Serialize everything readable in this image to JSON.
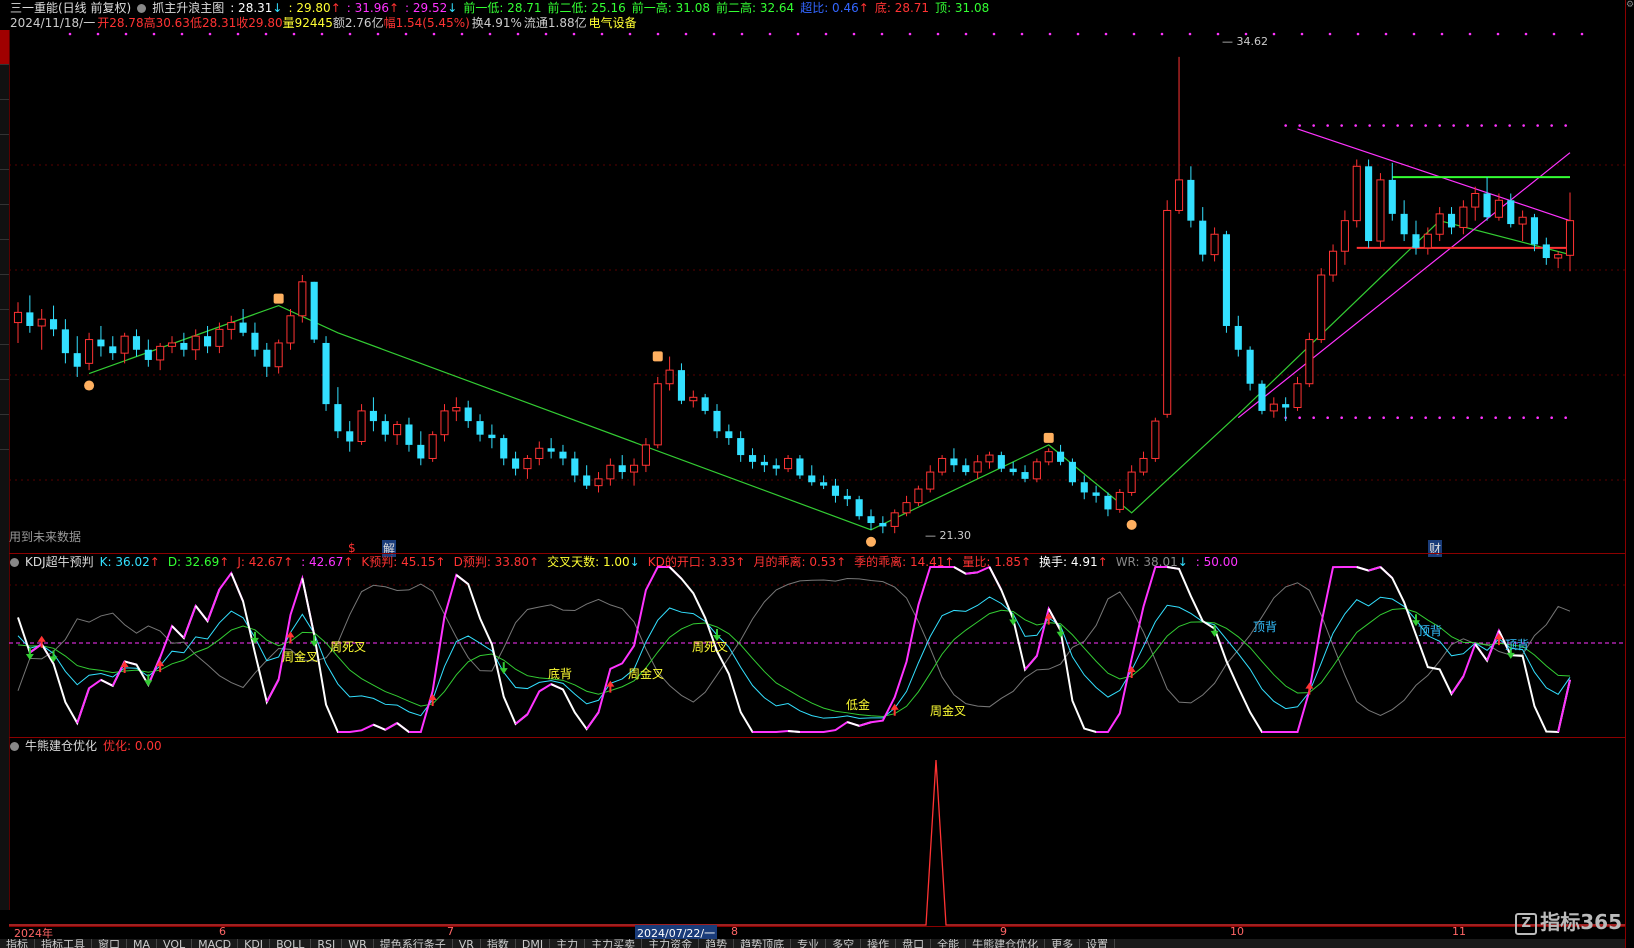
{
  "header": {
    "stock_name": "三一重能(日线 前复权)",
    "indicator": "抓主升浪主图",
    "v1_label": ": 28.31",
    "v1_arrow": "↓",
    "v2": ": 29.80",
    "v2_arrow": "↑",
    "v3": ": 31.96",
    "v3_arrow": "↑",
    "v4": ": 29.52",
    "v4_arrow": "↓",
    "prev_low": "前一低: 28.71",
    "prev2_low": "前二低: 25.16",
    "prev_high": "前一高: 31.08",
    "prev2_high": "前二高: 32.64",
    "ratio": "超比: 0.46",
    "ratio_arrow": "↑",
    "bottom": "底: 28.71",
    "top": "顶: 31.08"
  },
  "info": {
    "date": "2024/11/18/一",
    "open": "开28.78",
    "high": "高30.63",
    "low": "低28.31",
    "close": "收29.80",
    "volume": "量92445",
    "amount": "额2.76亿",
    "change": "幅1.54(5.45%)",
    "turnover": "换4.91%",
    "float": "流通1.88亿",
    "sector": "电气设备"
  },
  "main_notes": {
    "future_data": "用到未来数据",
    "price_high_label": "34.62",
    "price_low_label": "21.30",
    "sig_s": "$",
    "sig_jie": "解",
    "sig_cai": "财",
    "right_axis_mark": "2"
  },
  "kdj": {
    "title": "KDJ超牛预判",
    "items": [
      {
        "text": "K: 36.02",
        "arrow": "↑",
        "color": "#33e0ff"
      },
      {
        "text": "D: 32.69",
        "arrow": "↑",
        "color": "#33ff33"
      },
      {
        "text": "J: 42.67",
        "arrow": "↑",
        "color": "#ff3333"
      },
      {
        "text": ": 42.67",
        "arrow": "↑",
        "color": "#ff33ff"
      },
      {
        "text": "K预判: 45.15",
        "arrow": "↑",
        "color": "#ff3333"
      },
      {
        "text": "D预判: 33.80",
        "arrow": "↑",
        "color": "#ff3333"
      },
      {
        "text": "交叉天数: 1.00",
        "arrow": "↓",
        "color": "#ffff33"
      },
      {
        "text": "KD的开口: 3.33",
        "arrow": "↑",
        "color": "#ff3333"
      },
      {
        "text": "月的乖离: 0.53",
        "arrow": "↑",
        "color": "#ff3333"
      },
      {
        "text": "季的乖离: 14.41",
        "arrow": "↑",
        "color": "#ff3333"
      },
      {
        "text": "量比: 1.85",
        "arrow": "↑",
        "color": "#ff3333"
      },
      {
        "text": "换手: 4.91",
        "arrow": "↑",
        "color": "#ffffff"
      },
      {
        "text": "WR: 38.01",
        "arrow": "↓",
        "color": "#888888"
      },
      {
        "text": ": 50.00",
        "arrow": "",
        "color": "#ff33ff"
      }
    ],
    "labels": [
      {
        "text": "周死叉",
        "color": "#ffff33"
      },
      {
        "text": "周金叉",
        "color": "#ffff33"
      },
      {
        "text": "底背",
        "color": "#ffff33"
      },
      {
        "text": "周金叉",
        "color": "#ffff33"
      },
      {
        "text": "周死叉",
        "color": "#ffff33"
      },
      {
        "text": "低金",
        "color": "#ffff33"
      },
      {
        "text": "周金叉",
        "color": "#ffff33"
      },
      {
        "text": "顶背",
        "color": "#33c0ff"
      },
      {
        "text": "顶背",
        "color": "#33c0ff"
      },
      {
        "text": "顶背",
        "color": "#33c0ff"
      }
    ]
  },
  "bull": {
    "title": "牛熊建仓优化",
    "value_label": "优化: 0.00"
  },
  "dates": [
    {
      "text": "2024年"
    },
    {
      "text": "6"
    },
    {
      "text": "7"
    },
    {
      "text": "2024/07/22/一"
    },
    {
      "text": "8"
    },
    {
      "text": "9"
    },
    {
      "text": "10"
    },
    {
      "text": "11"
    }
  ],
  "tabs": [
    "指标",
    "指标工具",
    "窗口",
    "MA",
    "VOL",
    "MACD",
    "KDJ",
    "BOLL",
    "RSI",
    "WR",
    "提色系行条子",
    "VR",
    "指数",
    "DMI",
    "主力",
    "主力买卖",
    "主力资金",
    "趋势",
    "趋势顶底",
    "专业",
    "多空",
    "操作",
    "盘口",
    "全能",
    "牛熊建仓优化",
    "更多",
    "设置"
  ],
  "logo": {
    "mark": "Z",
    "text": "指标365"
  },
  "colors": {
    "up": "#ff3333",
    "down": "#33e0ff",
    "ma_green": "#33cc33",
    "magenta": "#ff33ff",
    "border": "#8b0000"
  },
  "chart_data": {
    "type": "candlestick",
    "title": "",
    "candles_ohlc": [
      [
        26.8,
        27.4,
        26.2,
        27.1
      ],
      [
        27.1,
        27.6,
        26.5,
        26.7
      ],
      [
        26.7,
        27.2,
        26.0,
        26.9
      ],
      [
        26.9,
        27.3,
        26.4,
        26.6
      ],
      [
        26.6,
        26.9,
        25.6,
        25.9
      ],
      [
        25.9,
        26.4,
        25.2,
        25.5
      ],
      [
        25.6,
        26.5,
        25.4,
        26.3
      ],
      [
        26.3,
        26.7,
        25.8,
        26.1
      ],
      [
        26.1,
        26.4,
        25.7,
        25.9
      ],
      [
        25.9,
        26.5,
        25.6,
        26.4
      ],
      [
        26.4,
        26.6,
        25.8,
        26.0
      ],
      [
        26.0,
        26.3,
        25.5,
        25.7
      ],
      [
        25.7,
        26.2,
        25.4,
        26.1
      ],
      [
        26.1,
        26.4,
        25.9,
        26.2
      ],
      [
        26.2,
        26.5,
        25.8,
        26.0
      ],
      [
        26.0,
        26.6,
        25.7,
        26.4
      ],
      [
        26.4,
        26.7,
        25.9,
        26.1
      ],
      [
        26.1,
        26.8,
        25.9,
        26.6
      ],
      [
        26.6,
        27.0,
        26.3,
        26.8
      ],
      [
        26.8,
        27.2,
        26.4,
        26.5
      ],
      [
        26.5,
        26.8,
        25.8,
        26.0
      ],
      [
        26.0,
        26.2,
        25.2,
        25.5
      ],
      [
        25.5,
        26.3,
        25.3,
        26.2
      ],
      [
        26.2,
        27.2,
        26.0,
        27.0
      ],
      [
        27.0,
        28.2,
        26.8,
        28.0
      ],
      [
        28.0,
        28.0,
        26.2,
        26.3
      ],
      [
        26.2,
        26.4,
        24.2,
        24.4
      ],
      [
        24.4,
        24.9,
        23.4,
        23.6
      ],
      [
        23.6,
        23.9,
        23.0,
        23.3
      ],
      [
        23.3,
        24.4,
        23.2,
        24.2
      ],
      [
        24.2,
        24.6,
        23.6,
        23.9
      ],
      [
        23.9,
        24.1,
        23.3,
        23.5
      ],
      [
        23.5,
        23.9,
        23.2,
        23.8
      ],
      [
        23.8,
        24.0,
        23.0,
        23.2
      ],
      [
        23.2,
        23.6,
        22.6,
        22.8
      ],
      [
        22.8,
        23.6,
        22.7,
        23.5
      ],
      [
        23.5,
        24.4,
        23.3,
        24.2
      ],
      [
        24.2,
        24.6,
        23.9,
        24.3
      ],
      [
        24.3,
        24.5,
        23.7,
        23.9
      ],
      [
        23.9,
        24.1,
        23.3,
        23.5
      ],
      [
        23.5,
        23.8,
        23.1,
        23.4
      ],
      [
        23.4,
        23.5,
        22.6,
        22.8
      ],
      [
        22.8,
        23.0,
        22.3,
        22.5
      ],
      [
        22.5,
        22.9,
        22.2,
        22.8
      ],
      [
        22.8,
        23.3,
        22.6,
        23.1
      ],
      [
        23.1,
        23.4,
        22.8,
        23.0
      ],
      [
        23.0,
        23.2,
        22.6,
        22.8
      ],
      [
        22.8,
        23.0,
        22.1,
        22.3
      ],
      [
        22.3,
        22.6,
        21.9,
        22.0
      ],
      [
        22.0,
        22.4,
        21.8,
        22.2
      ],
      [
        22.2,
        22.8,
        22.0,
        22.6
      ],
      [
        22.6,
        22.9,
        22.2,
        22.4
      ],
      [
        22.4,
        22.8,
        22.0,
        22.6
      ],
      [
        22.6,
        23.4,
        22.4,
        23.2
      ],
      [
        23.2,
        25.2,
        23.1,
        25.0
      ],
      [
        25.0,
        25.8,
        24.8,
        25.4
      ],
      [
        25.4,
        25.6,
        24.4,
        24.5
      ],
      [
        24.5,
        24.8,
        24.3,
        24.6
      ],
      [
        24.6,
        24.7,
        24.1,
        24.2
      ],
      [
        24.2,
        24.4,
        23.4,
        23.6
      ],
      [
        23.6,
        23.8,
        23.2,
        23.4
      ],
      [
        23.4,
        23.6,
        22.7,
        22.9
      ],
      [
        22.9,
        23.1,
        22.5,
        22.7
      ],
      [
        22.7,
        22.9,
        22.4,
        22.6
      ],
      [
        22.6,
        22.8,
        22.3,
        22.5
      ],
      [
        22.5,
        22.9,
        22.4,
        22.8
      ],
      [
        22.8,
        22.9,
        22.2,
        22.3
      ],
      [
        22.3,
        22.6,
        22.0,
        22.1
      ],
      [
        22.1,
        22.3,
        21.9,
        22.0
      ],
      [
        22.0,
        22.2,
        21.5,
        21.7
      ],
      [
        21.7,
        21.9,
        21.4,
        21.6
      ],
      [
        21.6,
        21.7,
        21.0,
        21.1
      ],
      [
        21.1,
        21.3,
        20.7,
        20.9
      ],
      [
        20.9,
        21.1,
        20.6,
        20.8
      ],
      [
        20.8,
        21.3,
        20.6,
        21.2
      ],
      [
        21.2,
        21.7,
        21.1,
        21.5
      ],
      [
        21.5,
        22.0,
        21.4,
        21.9
      ],
      [
        21.9,
        22.6,
        21.8,
        22.4
      ],
      [
        22.4,
        22.9,
        22.3,
        22.8
      ],
      [
        22.8,
        23.1,
        22.4,
        22.6
      ],
      [
        22.6,
        22.8,
        22.3,
        22.4
      ],
      [
        22.4,
        22.9,
        22.2,
        22.7
      ],
      [
        22.7,
        23.0,
        22.5,
        22.9
      ],
      [
        22.9,
        23.0,
        22.4,
        22.5
      ],
      [
        22.5,
        22.7,
        22.3,
        22.4
      ],
      [
        22.4,
        22.6,
        22.1,
        22.2
      ],
      [
        22.2,
        22.8,
        22.1,
        22.7
      ],
      [
        22.7,
        23.1,
        22.6,
        23.0
      ],
      [
        23.0,
        23.2,
        22.6,
        22.7
      ],
      [
        22.7,
        22.8,
        22.0,
        22.1
      ],
      [
        22.1,
        22.3,
        21.6,
        21.8
      ],
      [
        21.8,
        22.0,
        21.5,
        21.7
      ],
      [
        21.7,
        21.8,
        21.1,
        21.3
      ],
      [
        21.3,
        21.9,
        21.2,
        21.8
      ],
      [
        21.8,
        22.6,
        21.7,
        22.4
      ],
      [
        22.4,
        23.0,
        22.3,
        22.8
      ],
      [
        22.8,
        24.0,
        22.7,
        23.9
      ],
      [
        24.1,
        30.4,
        24.0,
        30.1
      ],
      [
        30.1,
        34.62,
        30.0,
        31.0
      ],
      [
        31.0,
        31.4,
        29.6,
        29.8
      ],
      [
        29.8,
        30.2,
        28.6,
        28.8
      ],
      [
        28.8,
        29.6,
        28.6,
        29.4
      ],
      [
        29.4,
        29.5,
        26.5,
        26.7
      ],
      [
        26.7,
        27.0,
        25.8,
        26.0
      ],
      [
        26.0,
        26.1,
        24.8,
        25.0
      ],
      [
        25.0,
        25.1,
        24.1,
        24.2
      ],
      [
        24.2,
        24.6,
        24.0,
        24.4
      ],
      [
        24.4,
        24.6,
        23.9,
        24.3
      ],
      [
        24.3,
        25.2,
        24.2,
        25.0
      ],
      [
        25.0,
        26.5,
        24.9,
        26.3
      ],
      [
        26.3,
        28.4,
        26.2,
        28.2
      ],
      [
        28.2,
        29.1,
        28.0,
        28.9
      ],
      [
        28.9,
        30.1,
        28.5,
        29.8
      ],
      [
        29.8,
        31.6,
        29.6,
        31.4
      ],
      [
        31.4,
        31.6,
        29.0,
        29.2
      ],
      [
        29.2,
        31.2,
        29.0,
        31.0
      ],
      [
        31.0,
        31.5,
        29.8,
        30.0
      ],
      [
        30.0,
        30.4,
        29.2,
        29.4
      ],
      [
        29.4,
        29.8,
        28.8,
        29.0
      ],
      [
        29.0,
        29.6,
        28.8,
        29.4
      ],
      [
        29.4,
        30.2,
        29.2,
        30.0
      ],
      [
        30.0,
        30.2,
        29.4,
        29.6
      ],
      [
        29.6,
        30.4,
        29.4,
        30.2
      ],
      [
        30.2,
        30.8,
        29.8,
        30.6
      ],
      [
        30.6,
        31.08,
        29.8,
        29.9
      ],
      [
        29.9,
        30.6,
        29.8,
        30.4
      ],
      [
        30.4,
        30.6,
        29.6,
        29.7
      ],
      [
        29.7,
        30.1,
        29.2,
        29.9
      ],
      [
        29.9,
        30.0,
        28.9,
        29.1
      ],
      [
        29.1,
        29.3,
        28.5,
        28.7
      ],
      [
        28.7,
        28.9,
        28.4,
        28.8
      ],
      [
        28.78,
        30.63,
        28.31,
        29.8
      ]
    ],
    "annotations": [
      "34.62",
      "21.30"
    ]
  }
}
